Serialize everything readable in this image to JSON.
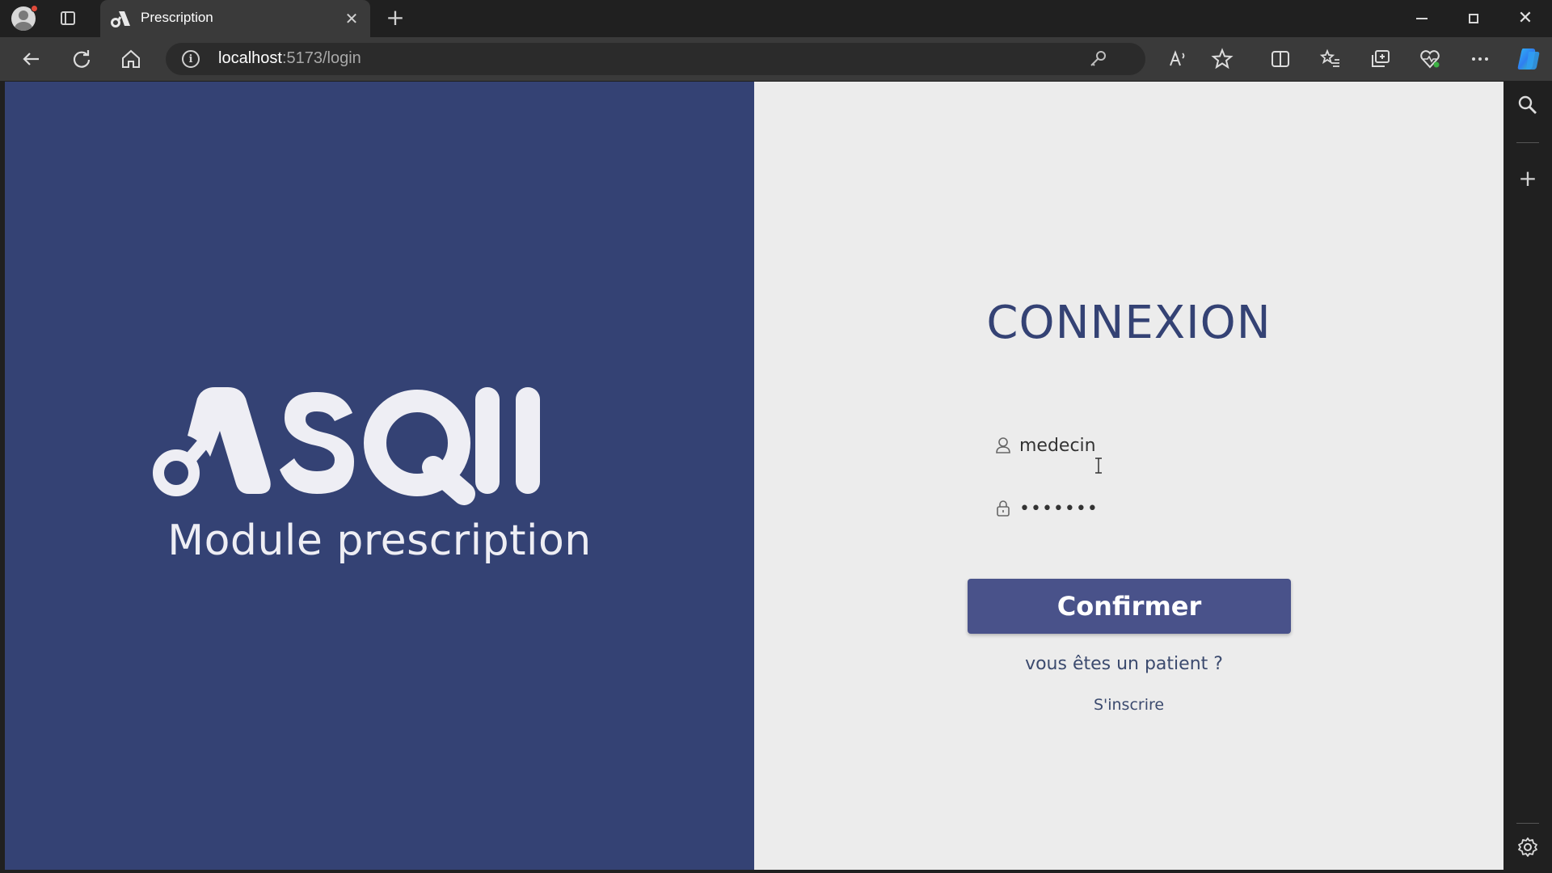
{
  "browser": {
    "tab_title": "Prescription",
    "url_host": "localhost",
    "url_path": ":5173/login",
    "new_tab_symbol": "+",
    "close_tab_symbol": "✕",
    "icons": [
      "profile-icon",
      "tab-actions-icon",
      "app-favicon",
      "back-icon",
      "refresh-icon",
      "home-icon",
      "info-icon",
      "password-key-icon",
      "read-aloud-icon",
      "favorite-star-icon",
      "split-screen-icon",
      "favorites-icon",
      "collections-icon",
      "browser-essentials-icon",
      "more-icon",
      "copilot-icon",
      "minimize-icon",
      "restore-icon",
      "close-icon"
    ]
  },
  "sidebar": {
    "icons": [
      "search-icon",
      "add-icon",
      "settings-icon"
    ]
  },
  "brand": {
    "logo_text": "ASQII",
    "subtitle": "Module prescription",
    "panel_color": "#344274"
  },
  "login": {
    "title": "CONNEXION",
    "username_value": "medecin",
    "password_value": "•••••••",
    "confirm_label": "Confirmer",
    "patient_question": "vous êtes un patient ?",
    "register_link": "S'inscrire",
    "accent_color": "#49528a"
  }
}
